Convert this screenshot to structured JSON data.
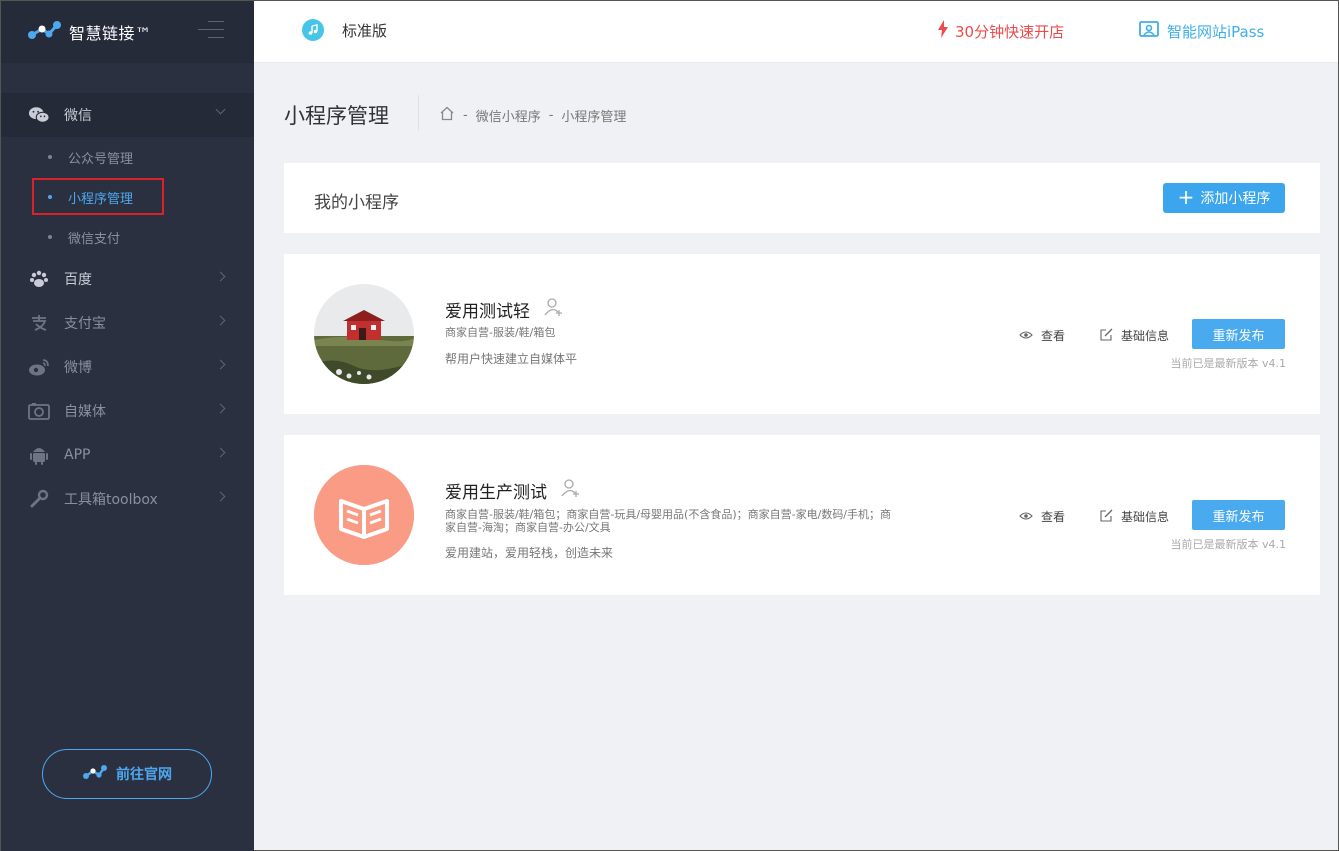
{
  "brand": {
    "name": "智慧链接™"
  },
  "topbar": {
    "edition": "标准版",
    "quick_open": "30分钟快速开店",
    "ipass": "智能网站iPass"
  },
  "sidebar": {
    "groups": [
      {
        "label": "微信",
        "icon": "wechat-icon",
        "open": true,
        "children": [
          {
            "label": "公众号管理",
            "active": false
          },
          {
            "label": "小程序管理",
            "active": true
          },
          {
            "label": "微信支付",
            "active": false
          }
        ]
      },
      {
        "label": "百度",
        "icon": "paw-icon"
      },
      {
        "label": "支付宝",
        "icon": "alipay-icon"
      },
      {
        "label": "微博",
        "icon": "weibo-icon"
      },
      {
        "label": "自媒体",
        "icon": "camera-icon"
      },
      {
        "label": "APP",
        "icon": "android-icon"
      },
      {
        "label": "工具箱toolbox",
        "icon": "wrench-icon"
      }
    ],
    "site_button": "前往官网"
  },
  "page": {
    "title": "小程序管理",
    "breadcrumb": [
      "微信小程序",
      "小程序管理"
    ]
  },
  "panel": {
    "title": "我的小程序",
    "add_button": "添加小程序"
  },
  "apps": [
    {
      "name": "爱用测试轻",
      "category": "商家自营-服装/鞋/箱包",
      "description": "帮用户快速建立自媒体平",
      "view_label": "查看",
      "info_label": "基础信息",
      "publish_label": "重新发布",
      "version": "当前已是最新版本 v4.1"
    },
    {
      "name": "爱用生产测试",
      "category": "商家自营-服装/鞋/箱包；商家自营-玩具/母婴用品(不含食品)；商家自营-家电/数码/手机；商家自营-海淘；商家自营-办公/文具",
      "description": "爱用建站，爱用轻栈，创造未来",
      "view_label": "查看",
      "info_label": "基础信息",
      "publish_label": "重新发布",
      "version": "当前已是最新版本 v4.1"
    }
  ],
  "colors": {
    "sidebar_bg": "#2b3040",
    "accent": "#3ba5ee",
    "danger": "#ee4b4b",
    "highlight_box": "#d9222a",
    "app2_avatar": "#f99b85"
  }
}
